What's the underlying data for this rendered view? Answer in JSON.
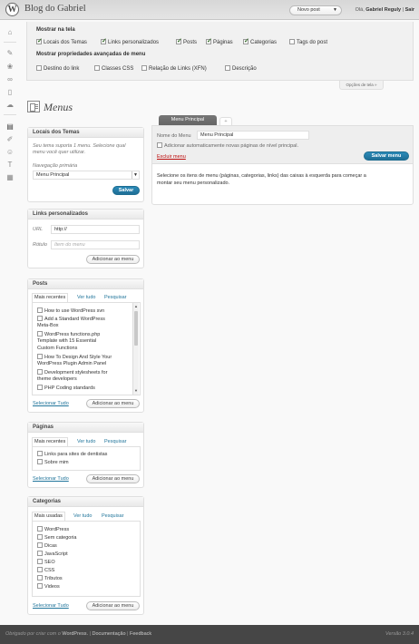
{
  "header": {
    "logo": "W",
    "blog_title": "Blog do Gabriel",
    "favorite_action": "Novo post",
    "greeting": "Olá,",
    "user_name": "Gabriel Reguly",
    "separator": "|",
    "logout": "Sair"
  },
  "screen_options": {
    "heading_show": "Mostrar na tela",
    "show_items": [
      {
        "label": "Locais dos Temas",
        "checked": true
      },
      {
        "label": "Links personalizados",
        "checked": true
      },
      {
        "label": "Posts",
        "checked": true
      },
      {
        "label": "Páginas",
        "checked": true
      },
      {
        "label": "Categorias",
        "checked": true
      },
      {
        "label": "Tags do post",
        "checked": false
      }
    ],
    "heading_advanced": "Mostrar propriedades avançadas de menu",
    "advanced_items": [
      {
        "label": "Destino do link",
        "checked": false
      },
      {
        "label": "Classes CSS",
        "checked": false
      },
      {
        "label": "Relação de Links (XFN)",
        "checked": false
      },
      {
        "label": "Descrição",
        "checked": false
      }
    ],
    "toggle_label": "Opções de tela »"
  },
  "page": {
    "title": "Menus"
  },
  "theme_locations": {
    "title": "Locais dos Temas",
    "info_line1": "Seu tema suporta 1 menu. Selecione qual",
    "info_line2": "menu você quer utilizar.",
    "nav_label": "Navegação primária",
    "selected_menu": "Menu Principal",
    "save_label": "Salvar"
  },
  "custom_links": {
    "title": "Links personalizados",
    "url_label": "URL",
    "url_value": "http://",
    "label_label": "Rótulo",
    "label_placeholder": "Item do menu",
    "add_label": "Adicionar ao menu"
  },
  "posts": {
    "title": "Posts",
    "tabs": [
      "Mais recentes",
      "Ver tudo",
      "Pesquisar"
    ],
    "items": [
      [
        "How to use WordPress svn"
      ],
      [
        "Add a Standard WordPress",
        "Meta-Box"
      ],
      [
        "WordPress functions.php",
        "Template with 15 Essential",
        "Custom Functions"
      ],
      [
        "How To Design And Style Your",
        "WordPress Plugin Admin Panel"
      ],
      [
        "Development stylesheets for",
        "theme developers"
      ],
      [
        "PHP Coding standards"
      ]
    ],
    "select_all": "Selecionar Tudo",
    "add_label": "Adicionar ao menu"
  },
  "pages": {
    "title": "Páginas",
    "tabs": [
      "Mais recentes",
      "Ver tudo",
      "Pesquisar"
    ],
    "items": [
      "Links para sites de dentistas",
      "Sobre mim"
    ],
    "select_all": "Selecionar Tudo",
    "add_label": "Adicionar ao menu"
  },
  "categories": {
    "title": "Categorias",
    "tabs": [
      "Mais usadas",
      "Ver tudo",
      "Pesquisar"
    ],
    "items": [
      "WordPress",
      "Sem categoria",
      "Dicas",
      "JavaScript",
      "SEO",
      "CSS",
      "Tributos",
      "Videos"
    ],
    "select_all": "Selecionar Tudo",
    "add_label": "Adicionar ao menu"
  },
  "menu_editor": {
    "tab_active": "Menu Principal",
    "tab_add": "+",
    "name_label": "Nome do Menu",
    "name_value": "Menu Principal",
    "auto_add_label": "Adicionar automaticamente novas páginas de nível principal.",
    "delete_label": "Excluir menu",
    "save_label": "Salvar menu",
    "instructions_line1": "Selecione os itens de menu (páginas, categorias, links) das caixas à esquerda para começar a",
    "instructions_line2": "montar seu menu personalizado."
  },
  "footer": {
    "thanks_prefix": "Obrigado por criar com o",
    "thanks_brand": "WordPress.",
    "sep": "|",
    "docs": "Documentação",
    "feedback": "Feedback",
    "version": "Versão 3.0.4"
  }
}
